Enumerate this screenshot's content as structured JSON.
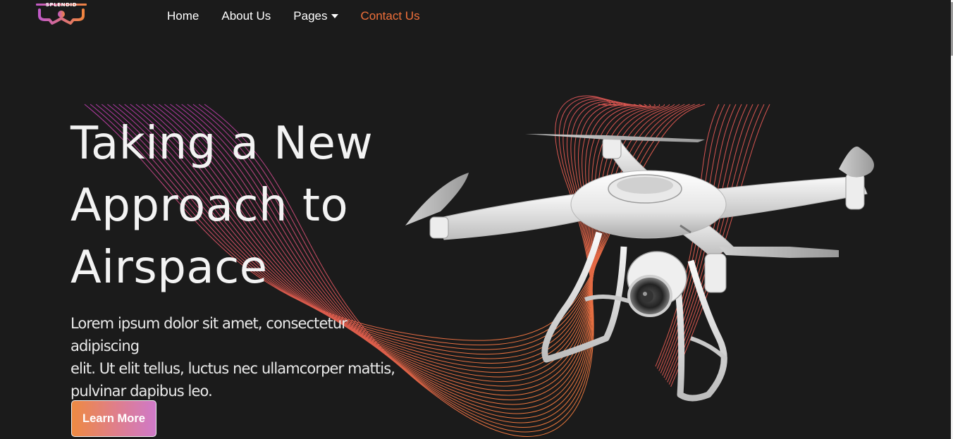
{
  "brand": {
    "logo_text": "SPLENDID",
    "icon": "drone-logo-icon",
    "gradient": [
      "#f0843f",
      "#c95fc9"
    ]
  },
  "nav": {
    "items": [
      {
        "label": "Home",
        "active": false
      },
      {
        "label": "About Us",
        "active": false
      },
      {
        "label": "Pages",
        "active": false,
        "has_dropdown": true,
        "dropdown_icon": "caret-down-icon"
      },
      {
        "label": "Contact Us",
        "active": true
      }
    ]
  },
  "hero": {
    "title_lines": [
      "Taking a New",
      "Approach to",
      "Airspace"
    ],
    "description_lines": [
      "Lorem ipsum dolor sit amet, consectetur adipiscing",
      "elit. Ut elit tellus, luctus nec ullamcorper mattis,",
      "pulvinar dapibus leo."
    ],
    "button_label": "Learn More",
    "image": "quadcopter-drone-image"
  },
  "colors": {
    "background": "#1b1b1b",
    "accent": "#f0703a",
    "line_gradient_start": "#b43fb0",
    "line_gradient_end": "#f07f35"
  }
}
